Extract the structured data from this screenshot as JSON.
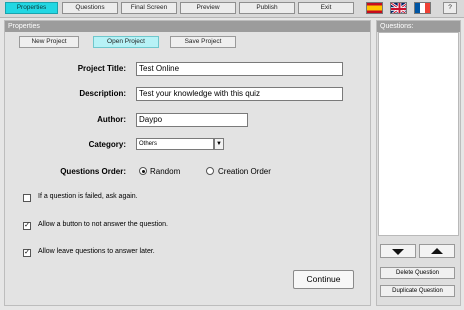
{
  "toolbar": {
    "properties": "Properties",
    "questions": "Questions",
    "final_screen": "Final Screen",
    "preview": "Preview",
    "publish": "Publish",
    "exit": "Exit",
    "help": "?"
  },
  "left_panel": {
    "title": "Properties",
    "new_project": "New Project",
    "open_project": "Open Project",
    "save_project": "Save Project"
  },
  "form": {
    "project_title_label": "Project Title:",
    "project_title_value": "Test Online",
    "description_label": "Description:",
    "description_value": "Test your knowledge with this quiz",
    "author_label": "Author:",
    "author_value": "Daypo",
    "category_label": "Category:",
    "category_value": "Others",
    "order_label": "Questions Order:",
    "order_random": "Random",
    "order_creation": "Creation Order",
    "order_selected": "Random"
  },
  "options": {
    "ask_again": "If a question is failed, ask again.",
    "ask_again_checked": false,
    "not_answer": "Allow a button to not answer the question.",
    "not_answer_checked": true,
    "answer_later": "Allow leave questions to answer later.",
    "answer_later_checked": true
  },
  "continue_label": "Continue",
  "right_panel": {
    "title": "Questions:",
    "delete": "Delete Question",
    "duplicate": "Duplicate Question"
  },
  "colors": {
    "active_tab": "#22d7e3",
    "panel_header": "#9c9c9c"
  }
}
